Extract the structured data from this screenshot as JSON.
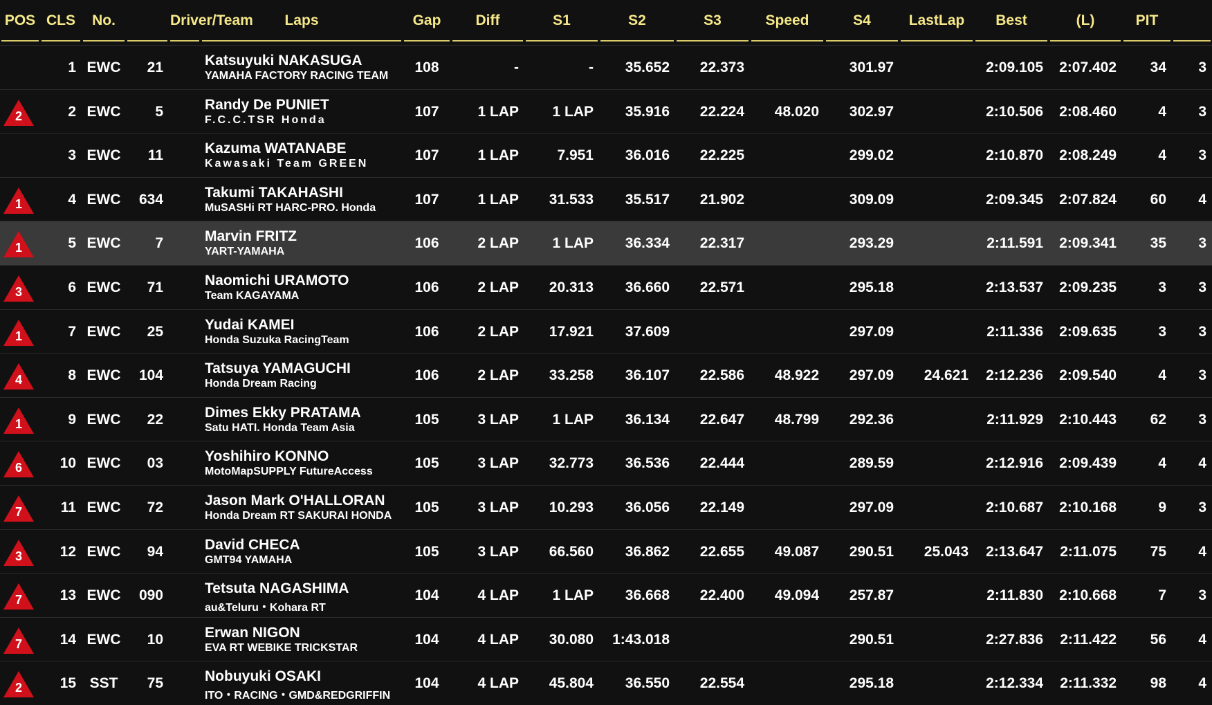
{
  "headers": [
    "POS",
    "CLS",
    "No.",
    "",
    "Driver/Team",
    "Laps",
    "Gap",
    "Diff",
    "S1",
    "S2",
    "S3",
    "Speed",
    "S4",
    "LastLap",
    "Best",
    "(L)",
    "PIT"
  ],
  "rows": [
    {
      "change": "",
      "pos": "1",
      "cls": "EWC",
      "no": "21",
      "driver": "Katsuyuki NAKASUGA",
      "team": "YAMAHA FACTORY RACING TEAM",
      "team_spaced": false,
      "laps": "108",
      "gap": "-",
      "diff": "-",
      "s1": "35.652",
      "s2": "22.373",
      "s3": "",
      "speed": "301.97",
      "s4": "",
      "lastlap": "2:09.105",
      "best": "2:07.402",
      "l": "34",
      "pit": "3",
      "highlight": false
    },
    {
      "change": "2",
      "pos": "2",
      "cls": "EWC",
      "no": "5",
      "driver": "Randy De PUNIET",
      "team": "F.C.C.TSR Honda",
      "team_spaced": true,
      "laps": "107",
      "gap": "1 LAP",
      "diff": "1 LAP",
      "s1": "35.916",
      "s2": "22.224",
      "s3": "48.020",
      "speed": "302.97",
      "s4": "",
      "lastlap": "2:10.506",
      "best": "2:08.460",
      "l": "4",
      "pit": "3",
      "highlight": false
    },
    {
      "change": "",
      "pos": "3",
      "cls": "EWC",
      "no": "11",
      "driver": "Kazuma WATANABE",
      "team": "Kawasaki Team GREEN",
      "team_spaced": true,
      "laps": "107",
      "gap": "1 LAP",
      "diff": "7.951",
      "s1": "36.016",
      "s2": "22.225",
      "s3": "",
      "speed": "299.02",
      "s4": "",
      "lastlap": "2:10.870",
      "best": "2:08.249",
      "l": "4",
      "pit": "3",
      "highlight": false
    },
    {
      "change": "1",
      "pos": "4",
      "cls": "EWC",
      "no": "634",
      "driver": "Takumi TAKAHASHI",
      "team": "MuSASHi RT HARC-PRO. Honda",
      "team_spaced": false,
      "laps": "107",
      "gap": "1 LAP",
      "diff": "31.533",
      "s1": "35.517",
      "s2": "21.902",
      "s3": "",
      "speed": "309.09",
      "s4": "",
      "lastlap": "2:09.345",
      "best": "2:07.824",
      "l": "60",
      "pit": "4",
      "highlight": false
    },
    {
      "change": "1",
      "pos": "5",
      "cls": "EWC",
      "no": "7",
      "driver": "Marvin FRITZ",
      "team": "YART-YAMAHA",
      "team_spaced": false,
      "laps": "106",
      "gap": "2 LAP",
      "diff": "1 LAP",
      "s1": "36.334",
      "s2": "22.317",
      "s3": "",
      "speed": "293.29",
      "s4": "",
      "lastlap": "2:11.591",
      "best": "2:09.341",
      "l": "35",
      "pit": "3",
      "highlight": true
    },
    {
      "change": "3",
      "pos": "6",
      "cls": "EWC",
      "no": "71",
      "driver": "Naomichi URAMOTO",
      "team": "Team KAGAYAMA",
      "team_spaced": false,
      "laps": "106",
      "gap": "2 LAP",
      "diff": "20.313",
      "s1": "36.660",
      "s2": "22.571",
      "s3": "",
      "speed": "295.18",
      "s4": "",
      "lastlap": "2:13.537",
      "best": "2:09.235",
      "l": "3",
      "pit": "3",
      "highlight": false
    },
    {
      "change": "1",
      "pos": "7",
      "cls": "EWC",
      "no": "25",
      "driver": "Yudai KAMEI",
      "team": "Honda Suzuka RacingTeam",
      "team_spaced": false,
      "laps": "106",
      "gap": "2 LAP",
      "diff": "17.921",
      "s1": "37.609",
      "s2": "",
      "s3": "",
      "speed": "297.09",
      "s4": "",
      "lastlap": "2:11.336",
      "best": "2:09.635",
      "l": "3",
      "pit": "3",
      "highlight": false
    },
    {
      "change": "4",
      "pos": "8",
      "cls": "EWC",
      "no": "104",
      "driver": "Tatsuya YAMAGUCHI",
      "team": "Honda Dream Racing",
      "team_spaced": false,
      "laps": "106",
      "gap": "2 LAP",
      "diff": "33.258",
      "s1": "36.107",
      "s2": "22.586",
      "s3": "48.922",
      "speed": "297.09",
      "s4": "24.621",
      "lastlap": "2:12.236",
      "best": "2:09.540",
      "l": "4",
      "pit": "3",
      "highlight": false
    },
    {
      "change": "1",
      "pos": "9",
      "cls": "EWC",
      "no": "22",
      "driver": "Dimes Ekky PRATAMA",
      "team": "Satu HATI. Honda Team Asia",
      "team_spaced": false,
      "laps": "105",
      "gap": "3 LAP",
      "diff": "1 LAP",
      "s1": "36.134",
      "s2": "22.647",
      "s3": "48.799",
      "speed": "292.36",
      "s4": "",
      "lastlap": "2:11.929",
      "best": "2:10.443",
      "l": "62",
      "pit": "3",
      "highlight": false
    },
    {
      "change": "6",
      "pos": "10",
      "cls": "EWC",
      "no": "03",
      "driver": "Yoshihiro KONNO",
      "team": "MotoMapSUPPLY FutureAccess",
      "team_spaced": false,
      "laps": "105",
      "gap": "3 LAP",
      "diff": "32.773",
      "s1": "36.536",
      "s2": "22.444",
      "s3": "",
      "speed": "289.59",
      "s4": "",
      "lastlap": "2:12.916",
      "best": "2:09.439",
      "l": "4",
      "pit": "4",
      "highlight": false
    },
    {
      "change": "7",
      "pos": "11",
      "cls": "EWC",
      "no": "72",
      "driver": "Jason Mark O'HALLORAN",
      "team": "Honda Dream RT SAKURAI HONDA",
      "team_spaced": false,
      "laps": "105",
      "gap": "3 LAP",
      "diff": "10.293",
      "s1": "36.056",
      "s2": "22.149",
      "s3": "",
      "speed": "297.09",
      "s4": "",
      "lastlap": "2:10.687",
      "best": "2:10.168",
      "l": "9",
      "pit": "3",
      "highlight": false
    },
    {
      "change": "3",
      "pos": "12",
      "cls": "EWC",
      "no": "94",
      "driver": "David CHECA",
      "team": "GMT94 YAMAHA",
      "team_spaced": false,
      "laps": "105",
      "gap": "3 LAP",
      "diff": "66.560",
      "s1": "36.862",
      "s2": "22.655",
      "s3": "49.087",
      "speed": "290.51",
      "s4": "25.043",
      "lastlap": "2:13.647",
      "best": "2:11.075",
      "l": "75",
      "pit": "4",
      "highlight": false
    },
    {
      "change": "7",
      "pos": "13",
      "cls": "EWC",
      "no": "090",
      "driver": "Tetsuta NAGASHIMA",
      "team": "au&Teluru・Kohara RT",
      "team_spaced": false,
      "laps": "104",
      "gap": "4 LAP",
      "diff": "1 LAP",
      "s1": "36.668",
      "s2": "22.400",
      "s3": "49.094",
      "speed": "257.87",
      "s4": "",
      "lastlap": "2:11.830",
      "best": "2:10.668",
      "l": "7",
      "pit": "3",
      "highlight": false
    },
    {
      "change": "7",
      "pos": "14",
      "cls": "EWC",
      "no": "10",
      "driver": "Erwan NIGON",
      "team": "EVA RT WEBIKE TRICKSTAR",
      "team_spaced": false,
      "laps": "104",
      "gap": "4 LAP",
      "diff": "30.080",
      "s1": "1:43.018",
      "s2": "",
      "s3": "",
      "speed": "290.51",
      "s4": "",
      "lastlap": "2:27.836",
      "best": "2:11.422",
      "l": "56",
      "pit": "4",
      "highlight": false
    },
    {
      "change": "2",
      "pos": "15",
      "cls": "SST",
      "no": "75",
      "driver": "Nobuyuki OSAKI",
      "team": "ITO・RACING・GMD&REDGRIFFIN",
      "team_spaced": false,
      "laps": "104",
      "gap": "4 LAP",
      "diff": "45.804",
      "s1": "36.550",
      "s2": "22.554",
      "s3": "",
      "speed": "295.18",
      "s4": "",
      "lastlap": "2:12.334",
      "best": "2:11.332",
      "l": "98",
      "pit": "4",
      "highlight": false
    }
  ],
  "colors": {
    "background": "#111111",
    "header_text": "#f6e88a",
    "header_rule": "#d9cb6a",
    "highlight_row": "#3a3a3a",
    "badge_fill": "#d0101a",
    "text": "#ffffff"
  }
}
